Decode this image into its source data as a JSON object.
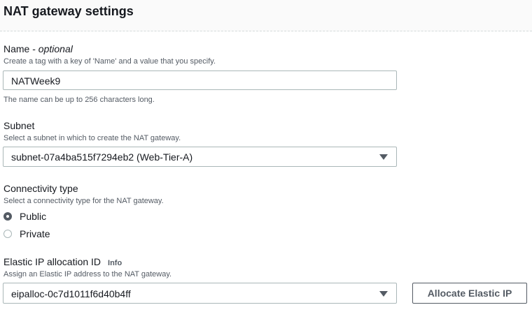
{
  "header": {
    "title": "NAT gateway settings"
  },
  "name_field": {
    "label": "Name - ",
    "label_optional": "optional",
    "description": "Create a tag with a key of 'Name' and a value that you specify.",
    "value": "NATWeek9",
    "constraint": "The name can be up to 256 characters long."
  },
  "subnet_field": {
    "label": "Subnet",
    "description": "Select a subnet in which to create the NAT gateway.",
    "selected": "subnet-07a4ba515f7294eb2 (Web-Tier-A)"
  },
  "connectivity": {
    "label": "Connectivity type",
    "description": "Select a connectivity type for the NAT gateway.",
    "options": [
      {
        "label": "Public",
        "checked": true
      },
      {
        "label": "Private",
        "checked": false
      }
    ]
  },
  "elastic_ip": {
    "label": "Elastic IP allocation ID",
    "info": "Info",
    "description": "Assign an Elastic IP address to the NAT gateway.",
    "selected": "eipalloc-0c7d1011f6d40b4ff",
    "allocate_button": "Allocate Elastic IP"
  }
}
